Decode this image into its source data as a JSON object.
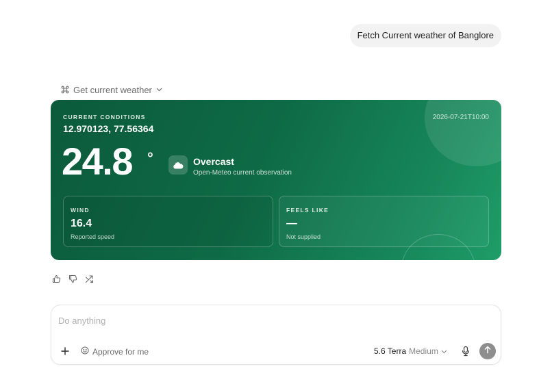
{
  "conversation": {
    "user_message": "Fetch Current weather of Banglore",
    "tool_call": {
      "label": "Get current weather",
      "icon": "command-icon",
      "toggle_icon": "chevron-down-icon"
    }
  },
  "weather_card": {
    "section_label": "CURRENT CONDITIONS",
    "coordinates": "12.970123, 77.56364",
    "timestamp": "2026-07-21T10:00",
    "temperature": "24.8",
    "temperature_unit": "°",
    "condition": "Overcast",
    "condition_icon": "cloud-icon",
    "condition_source": "Open-Meteo current observation",
    "stats": [
      {
        "label": "WIND",
        "value": "16.4",
        "note": "Reported speed"
      },
      {
        "label": "FEELS LIKE",
        "value": "—",
        "note": "Not supplied"
      }
    ],
    "colors": {
      "gradient_start": "#0b5a3c",
      "gradient_end": "#1f9d68"
    }
  },
  "feedback": {
    "icons": [
      "thumbs-up-icon",
      "thumbs-down-icon",
      "share-icon"
    ]
  },
  "composer": {
    "placeholder": "Do anything",
    "value": "",
    "approve_label": "Approve for me",
    "model_name": "5.6 Terra",
    "model_effort": "Medium",
    "send_color": "#8e8e8e"
  }
}
